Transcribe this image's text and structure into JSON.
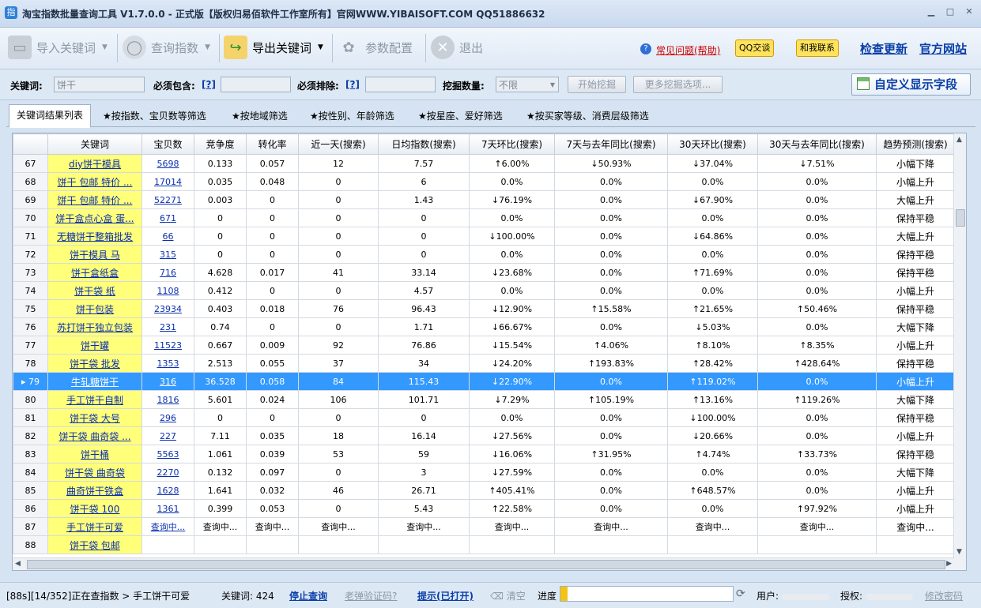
{
  "window": {
    "title": "淘宝指数批量查询工具 V1.7.0.0 - 正式版【版权归易佰软件工作室所有】官网WWW.YIBAISOFT.COM QQ51886632",
    "icon_text": "指"
  },
  "toolbar": {
    "import_label": "导入关键词",
    "query_label": "查询指数",
    "export_label": "导出关键词",
    "settings_label": "参数配置",
    "exit_label": "退出",
    "faq_label": "常见问题(帮助)",
    "qq_label": "QQ交谈",
    "contact_label": "和我联系",
    "update_label": "检查更新",
    "site_label": "官方网站"
  },
  "search": {
    "keyword_label": "关键词:",
    "keyword_value": "饼干",
    "must_include_label": "必须包含:",
    "must_exclude_label": "必须排除:",
    "help_link": "[?]",
    "count_label": "挖掘数量:",
    "count_value": "不限",
    "start_label": "开始挖掘",
    "more_label": "更多挖掘选项...",
    "custom_fields_label": "自定义显示字段"
  },
  "tabs": [
    "关键词结果列表",
    "★按指数、宝贝数等筛选",
    "★按地域筛选",
    "★按性别、年龄筛选",
    "★按星座、爱好筛选",
    "★按买家等级、消费层级筛选"
  ],
  "grid": {
    "columns": [
      "",
      "关键词",
      "宝贝数",
      "竞争度",
      "转化率",
      "近一天(搜索)",
      "日均指数(搜索)",
      "7天环比(搜索)",
      "7天与去年同比(搜索)",
      "30天环比(搜索)",
      "30天与去年同比(搜索)",
      "趋势预测(搜索)"
    ],
    "selected_row": 79,
    "rows": [
      [
        "67",
        "diy饼干模具",
        "5698",
        "0.133",
        "0.057",
        "12",
        "7.57",
        "↑6.00%",
        "↓50.93%",
        "↓37.04%",
        "↓7.51%",
        "小幅下降"
      ],
      [
        "68",
        "饼干 包邮 特价 ...",
        "17014",
        "0.035",
        "0.048",
        "0",
        "6",
        "0.0%",
        "0.0%",
        "0.0%",
        "0.0%",
        "小幅上升"
      ],
      [
        "69",
        "饼干 包邮 特价 ...",
        "52271",
        "0.003",
        "0",
        "0",
        "1.43",
        "↓76.19%",
        "0.0%",
        "↓67.90%",
        "0.0%",
        "大幅上升"
      ],
      [
        "70",
        "饼干盒点心盒 蛋...",
        "671",
        "0",
        "0",
        "0",
        "0",
        "0.0%",
        "0.0%",
        "0.0%",
        "0.0%",
        "保持平稳"
      ],
      [
        "71",
        "无糖饼干整箱批发",
        "66",
        "0",
        "0",
        "0",
        "0",
        "↓100.00%",
        "0.0%",
        "↓64.86%",
        "0.0%",
        "大幅上升"
      ],
      [
        "72",
        "饼干模具 马",
        "315",
        "0",
        "0",
        "0",
        "0",
        "0.0%",
        "0.0%",
        "0.0%",
        "0.0%",
        "保持平稳"
      ],
      [
        "73",
        "饼干盒纸盒",
        "716",
        "4.628",
        "0.017",
        "41",
        "33.14",
        "↓23.68%",
        "0.0%",
        "↑71.69%",
        "0.0%",
        "保持平稳"
      ],
      [
        "74",
        "饼干袋 纸",
        "1108",
        "0.412",
        "0",
        "0",
        "4.57",
        "0.0%",
        "0.0%",
        "0.0%",
        "0.0%",
        "小幅上升"
      ],
      [
        "75",
        "饼干包装",
        "23934",
        "0.403",
        "0.018",
        "76",
        "96.43",
        "↓12.90%",
        "↑15.58%",
        "↑21.65%",
        "↑50.46%",
        "保持平稳"
      ],
      [
        "76",
        "苏打饼干独立包装",
        "231",
        "0.74",
        "0",
        "0",
        "1.71",
        "↓66.67%",
        "0.0%",
        "↓5.03%",
        "0.0%",
        "大幅下降"
      ],
      [
        "77",
        "饼干罐",
        "11523",
        "0.667",
        "0.009",
        "92",
        "76.86",
        "↓15.54%",
        "↑4.06%",
        "↑8.10%",
        "↑8.35%",
        "小幅上升"
      ],
      [
        "78",
        "饼干袋 批发",
        "1353",
        "2.513",
        "0.055",
        "37",
        "34",
        "↓24.20%",
        "↑193.83%",
        "↑28.42%",
        "↑428.64%",
        "保持平稳"
      ],
      [
        "79",
        "牛轧糖饼干",
        "316",
        "36.528",
        "0.058",
        "84",
        "115.43",
        "↓22.90%",
        "0.0%",
        "↑119.02%",
        "0.0%",
        "小幅上升"
      ],
      [
        "80",
        "手工饼干自制",
        "1816",
        "5.601",
        "0.024",
        "106",
        "101.71",
        "↓7.29%",
        "↑105.19%",
        "↑13.16%",
        "↑119.26%",
        "大幅下降"
      ],
      [
        "81",
        "饼干袋 大号",
        "296",
        "0",
        "0",
        "0",
        "0",
        "0.0%",
        "0.0%",
        "↓100.00%",
        "0.0%",
        "保持平稳"
      ],
      [
        "82",
        "饼干袋 曲奇袋 ...",
        "227",
        "7.11",
        "0.035",
        "18",
        "16.14",
        "↓27.56%",
        "0.0%",
        "↓20.66%",
        "0.0%",
        "小幅上升"
      ],
      [
        "83",
        "饼干桶",
        "5563",
        "1.061",
        "0.039",
        "53",
        "59",
        "↓16.06%",
        "↑31.95%",
        "↑4.74%",
        "↑33.73%",
        "保持平稳"
      ],
      [
        "84",
        "饼干袋 曲奇袋",
        "2270",
        "0.132",
        "0.097",
        "0",
        "3",
        "↓27.59%",
        "0.0%",
        "0.0%",
        "0.0%",
        "大幅下降"
      ],
      [
        "85",
        "曲奇饼干铁盒",
        "1628",
        "1.641",
        "0.032",
        "46",
        "26.71",
        "↑405.41%",
        "0.0%",
        "↑648.57%",
        "0.0%",
        "小幅上升"
      ],
      [
        "86",
        "饼干袋 100",
        "1361",
        "0.399",
        "0.053",
        "0",
        "5.43",
        "↑22.58%",
        "0.0%",
        "0.0%",
        "↑97.92%",
        "小幅上升"
      ],
      [
        "87",
        "手工饼干可爱",
        "查询中...",
        "查询中...",
        "查询中...",
        "查询中...",
        "查询中...",
        "查询中...",
        "查询中...",
        "查询中...",
        "查询中...",
        "查询中..."
      ],
      [
        "88",
        "饼干袋 包邮",
        "",
        "",
        "",
        "",
        "",
        "",
        "",
        "",
        "",
        ""
      ]
    ]
  },
  "status": {
    "progress_text": "[88s][14/352]正在查指数 > 手工饼干可爱",
    "keyword_count": "关键词: 424",
    "stop_label": "停止查询",
    "captcha_label": "老弹验证码?",
    "hint_label": "提示(已打开)",
    "clear_label": "清空",
    "progress_label": "进度",
    "progress_fraction": 0.04,
    "user_label": "用户:",
    "auth_label": "授权:",
    "change_pwd_label": "修改密码"
  }
}
